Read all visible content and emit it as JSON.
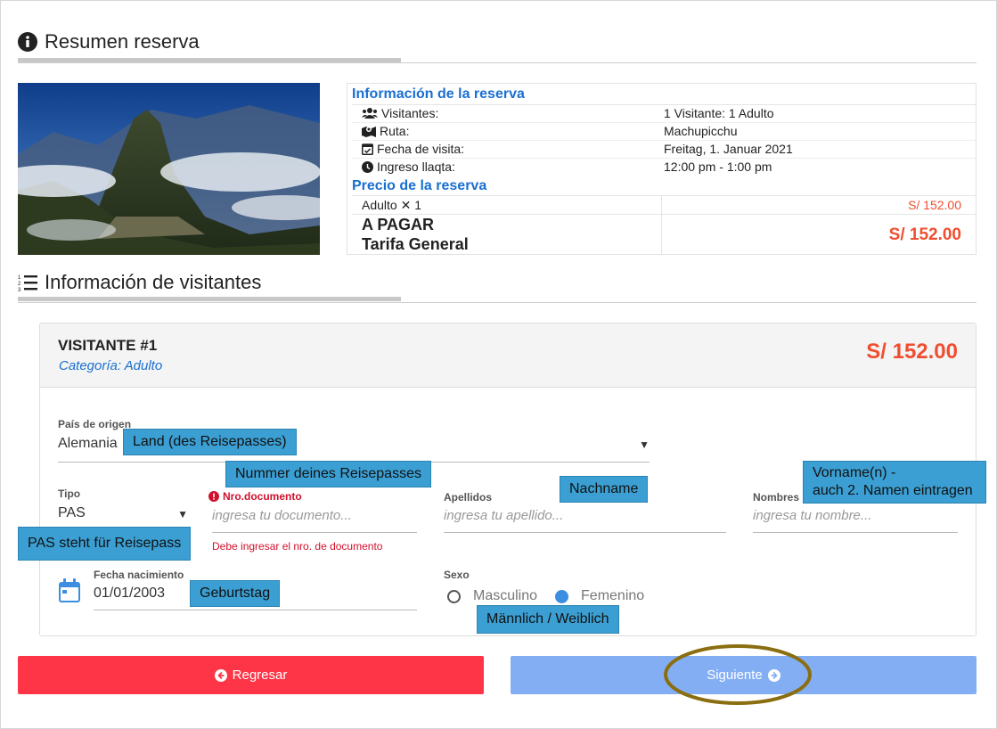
{
  "summary": {
    "title": "Resumen reserva",
    "info_heading": "Información de la reserva",
    "rows": [
      {
        "label": "Visitantes:",
        "value": "1 Visitante: 1 Adulto"
      },
      {
        "label": "Ruta:",
        "value": "Machupicchu"
      },
      {
        "label": "Fecha de visita:",
        "value": "Freitag, 1. Januar 2021"
      },
      {
        "label": "Ingreso llaqta:",
        "value": "12:00 pm - 1:00 pm"
      }
    ],
    "price_heading": "Precio de la reserva",
    "adult_line": "Adulto ✕ 1",
    "adult_price": "S/ 152.00",
    "to_pay_label": "A PAGAR",
    "tariff_label": "Tarifa General",
    "total": "S/ 152.00"
  },
  "visitors": {
    "title": "Información de visitantes",
    "card": {
      "heading": "VISITANTE #1",
      "category": "Categoría: Adulto",
      "price": "S/ 152.00",
      "country": {
        "label": "País de origen",
        "value": "Alemania"
      },
      "type": {
        "label": "Tipo",
        "value": "PAS"
      },
      "document": {
        "label": "Nro.documento",
        "placeholder": "ingresa tu documento...",
        "error": "Debe ingresar el nro. de documento"
      },
      "surname": {
        "label": "Apellidos",
        "placeholder": "ingresa tu apellido..."
      },
      "names": {
        "label": "Nombres",
        "placeholder": "ingresa tu nombre..."
      },
      "birth": {
        "label": "Fecha nacimiento",
        "value": "01/01/2003"
      },
      "sex": {
        "label": "Sexo",
        "male": "Masculino",
        "female": "Femenino",
        "selected": "Femenino"
      }
    }
  },
  "annotations": {
    "country": "Land (des Reisepasses)",
    "document": "Nummer deines Reisepasses",
    "surname": "Nachname",
    "names_line1": "Vorname(n) -",
    "names_line2": "auch 2. Namen eintragen",
    "type": "PAS steht für Reisepass",
    "birth": "Geburtstag",
    "sex": "Männlich / Weiblich"
  },
  "buttons": {
    "back": "Regresar",
    "next": "Siguiente"
  },
  "colors": {
    "blue_heading": "#1a6fd1",
    "price_red": "#f04e30",
    "back_btn": "#fe3547",
    "next_btn": "#84aef4",
    "tip_bg": "#3b9fd3",
    "circle": "#8a6e10"
  }
}
